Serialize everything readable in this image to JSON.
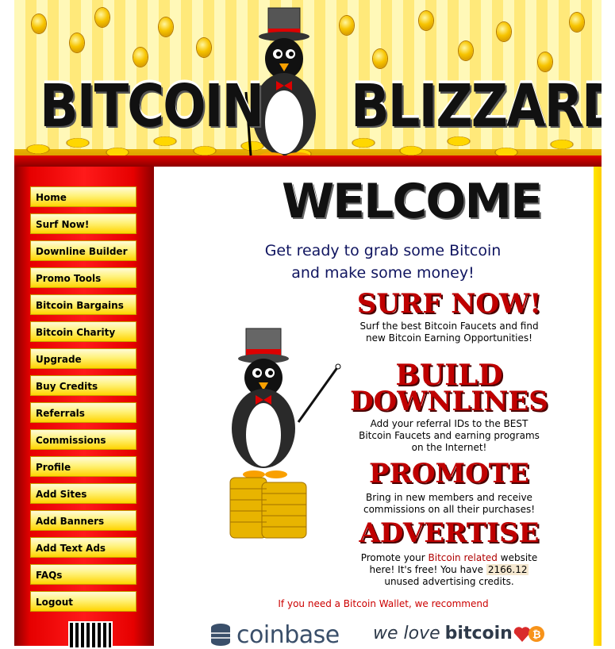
{
  "header": {
    "logo_left": "BITCOIN",
    "logo_right": "BLIZZARD"
  },
  "sidebar": {
    "items": [
      {
        "label": "Home"
      },
      {
        "label": "Surf Now!"
      },
      {
        "label": "Downline Builder"
      },
      {
        "label": "Promo Tools"
      },
      {
        "label": "Bitcoin Bargains"
      },
      {
        "label": "Bitcoin Charity"
      },
      {
        "label": "Upgrade"
      },
      {
        "label": "Buy Credits"
      },
      {
        "label": "Referrals"
      },
      {
        "label": "Commissions"
      },
      {
        "label": "Profile"
      },
      {
        "label": "Add Sites"
      },
      {
        "label": "Add Banners"
      },
      {
        "label": "Add Text Ads"
      },
      {
        "label": "FAQs"
      },
      {
        "label": "Logout"
      }
    ]
  },
  "main": {
    "welcome": "WELCOME",
    "tagline_line1": "Get ready to grab some Bitcoin",
    "tagline_line2": "and make some money!",
    "sections": {
      "surf": {
        "heading": "SURF NOW!",
        "text": "Surf the best Bitcoin Faucets and find new Bitcoin Earning Opportunities!"
      },
      "build": {
        "heading_line1": "BUILD",
        "heading_line2": "DOWNLINES",
        "text": "Add your referral IDs to the BEST Bitcoin Faucets and earning programs on the Internet!"
      },
      "promote": {
        "heading": "PROMOTE",
        "text": "Bring in new members and receive commissions on all their purchases!"
      },
      "advertise": {
        "heading": "ADVERTISE",
        "text_pre": "Promote your ",
        "link": "Bitcoin related",
        "text_mid": " website here! It's free! You have ",
        "credits": "2166.12",
        "text_post": " unused advertising credits."
      }
    },
    "wallet_note": "If you need a Bitcoin Wallet, we recommend",
    "coinbase": "coinbase",
    "we_love": "we love",
    "bitcoin_word": "bitcoin"
  },
  "colors": {
    "sidebar_red": "#e60000",
    "nav_yellow": "#fff27a",
    "heading_red": "#c00000",
    "tagline_navy": "#101560"
  }
}
